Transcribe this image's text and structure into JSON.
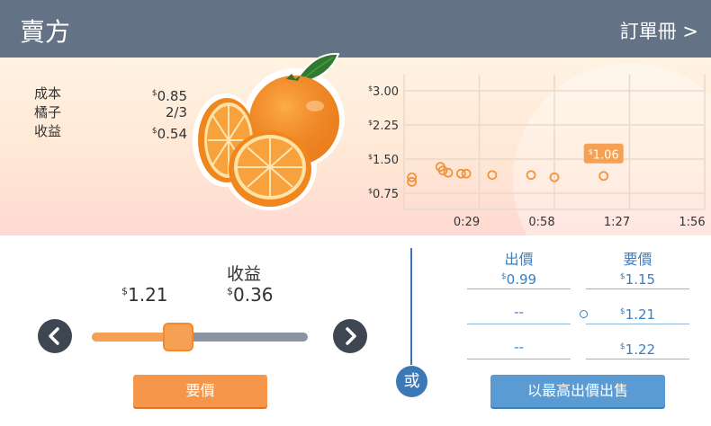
{
  "header": {
    "title": "賣方",
    "order_book_link": "訂單冊 >"
  },
  "stats": {
    "currency_symbol": "$",
    "cost_label": "成本",
    "cost_value": "0.85",
    "oranges_label": "橘子",
    "oranges_value": "2/3",
    "profit_label": "收益",
    "profit_value": "0.54"
  },
  "chart_data": {
    "type": "scatter",
    "y_ticks": [
      "3.00",
      "2.25",
      "1.50",
      "0.75"
    ],
    "x_ticks": [
      "0:29",
      "0:58",
      "1:27",
      "1:56"
    ],
    "ylim": [
      0.75,
      3.0
    ],
    "xlim_seconds": [
      0,
      116
    ],
    "grid": true,
    "currency_symbol": "$",
    "points": [
      {
        "t": 3,
        "y": 1.0
      },
      {
        "t": 3,
        "y": 1.1
      },
      {
        "t": 14,
        "y": 1.33
      },
      {
        "t": 15,
        "y": 1.25
      },
      {
        "t": 17,
        "y": 1.2
      },
      {
        "t": 22,
        "y": 1.18
      },
      {
        "t": 24,
        "y": 1.18
      },
      {
        "t": 34,
        "y": 1.15
      },
      {
        "t": 49,
        "y": 1.15
      },
      {
        "t": 58,
        "y": 1.1
      },
      {
        "t": 77,
        "y": 1.13
      }
    ],
    "current_label": "1.06",
    "current_point_index": 10
  },
  "controls": {
    "profit_label": "收益",
    "ask_price": "1.21",
    "profit_value": "0.36",
    "currency_symbol": "$",
    "slider_level": 0.4,
    "prev_icon": "chevron-left-icon",
    "next_icon": "chevron-right-icon",
    "ask_button_label": "要價"
  },
  "order_book": {
    "bid_header": "出價",
    "ask_header": "要價",
    "currency_symbol": "$",
    "bids": [
      "0.99",
      "--",
      "--"
    ],
    "asks": [
      "1.15",
      "1.21",
      "1.22"
    ],
    "or_label": "或",
    "sell_button_label": "以最高出價出售"
  },
  "colors": {
    "header_bg": "#647286",
    "accent_orange": "#f5964a",
    "accent_blue": "#3a7ec4"
  }
}
